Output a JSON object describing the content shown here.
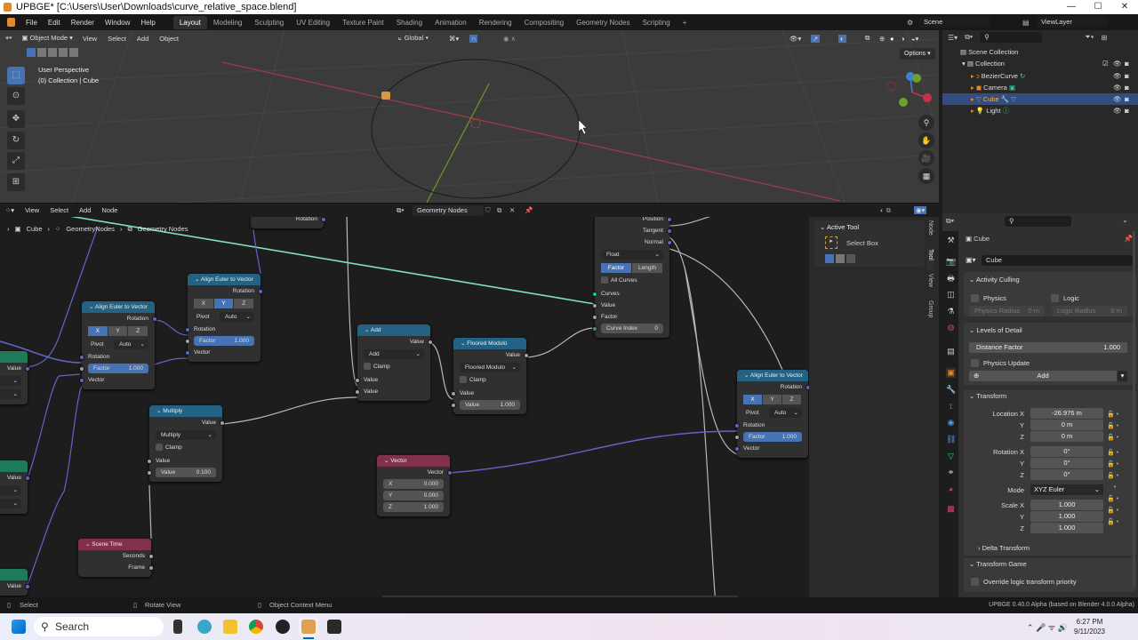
{
  "window": {
    "title": "UPBGE* [C:\\Users\\User\\Downloads\\curve_relative_space.blend]",
    "controls": [
      "—",
      "☐",
      "✕"
    ]
  },
  "topbar": {
    "menus": [
      "File",
      "Edit",
      "Render",
      "Window",
      "Help"
    ],
    "workspaces": [
      "Layout",
      "Modeling",
      "Sculpting",
      "UV Editing",
      "Texture Paint",
      "Shading",
      "Animation",
      "Rendering",
      "Compositing",
      "Geometry Nodes",
      "Scripting"
    ],
    "active_workspace": "Layout",
    "add_workspace": "+",
    "scene": "Scene",
    "view_layer": "ViewLayer"
  },
  "viewport": {
    "mode": "Object Mode",
    "menus": [
      "View",
      "Select",
      "Add",
      "Object"
    ],
    "orientation": "Global",
    "options_label": "Options",
    "overlay_line1": "User Perspective",
    "overlay_line2": "(0) Collection | Cube",
    "gizmo_axes": [
      "X",
      "Y",
      "Z"
    ],
    "axis_colors": {
      "x": "#c8304a",
      "y": "#6aa12a",
      "z": "#3d82d6"
    }
  },
  "node_editor": {
    "menus": [
      "View",
      "Select",
      "Add",
      "Node"
    ],
    "node_tree": "Geometry Nodes",
    "breadcrumb": [
      "Cube",
      "GeometryNodes",
      "Geometry Nodes"
    ],
    "nodes": [
      {
        "title": "",
        "color": "#303030",
        "rows": [
          {
            "t": "out",
            "label": "Rotation",
            "s": "#6363c7"
          }
        ]
      },
      {
        "title": "Align Euler to Vector",
        "color": "#246283",
        "rows": [
          {
            "t": "out",
            "label": "Rotation",
            "s": "#6363c7"
          },
          {
            "t": "seg",
            "options": [
              "X",
              "Y",
              "Z"
            ],
            "active": "X"
          },
          {
            "t": "sel",
            "label": "Pivot",
            "value": "Auto"
          },
          {
            "t": "in",
            "label": "Rotation",
            "s": "#6363c7"
          },
          {
            "t": "field",
            "label": "Factor",
            "value": "1.000",
            "hl": true,
            "s": "#a1a1a1"
          },
          {
            "t": "in",
            "label": "Vector",
            "s": "#6363c7"
          }
        ]
      },
      {
        "title": "Align Euler to Vector",
        "color": "#246283",
        "rows": [
          {
            "t": "out",
            "label": "Rotation",
            "s": "#6363c7"
          },
          {
            "t": "seg",
            "options": [
              "X",
              "Y",
              "Z"
            ],
            "active": "Y"
          },
          {
            "t": "sel",
            "label": "Pivot",
            "value": "Auto"
          },
          {
            "t": "in",
            "label": "Rotation",
            "s": "#6363c7"
          },
          {
            "t": "field",
            "label": "Factor",
            "value": "1.000",
            "hl": true,
            "s": "#a1a1a1"
          },
          {
            "t": "in",
            "label": "Vector",
            "s": "#6363c7"
          }
        ]
      },
      {
        "title": "Align Euler to Vector",
        "color": "#246283",
        "rows": [
          {
            "t": "out",
            "label": "Rotation",
            "s": "#6363c7"
          },
          {
            "t": "seg",
            "options": [
              "X",
              "Y",
              "Z"
            ],
            "active": "X"
          },
          {
            "t": "sel",
            "label": "Pivot",
            "value": "Auto"
          },
          {
            "t": "in",
            "label": "Rotation",
            "s": "#6363c7"
          },
          {
            "t": "field",
            "label": "Factor",
            "value": "1.000",
            "hl": true,
            "s": "#a1a1a1"
          },
          {
            "t": "in",
            "label": "Vector",
            "s": "#6363c7"
          }
        ]
      },
      {
        "title": "Add",
        "color": "#246283",
        "rows": [
          {
            "t": "out",
            "label": "Value",
            "s": "#a1a1a1"
          },
          {
            "t": "sel",
            "value": "Add"
          },
          {
            "t": "check",
            "label": "Clamp"
          },
          {
            "t": "in",
            "label": "Value",
            "s": "#a1a1a1"
          },
          {
            "t": "in",
            "label": "Value",
            "s": "#a1a1a1"
          }
        ]
      },
      {
        "title": "Floored Modulo",
        "color": "#246283",
        "rows": [
          {
            "t": "out",
            "label": "Value",
            "s": "#a1a1a1"
          },
          {
            "t": "sel",
            "value": "Floored Modulo"
          },
          {
            "t": "check",
            "label": "Clamp"
          },
          {
            "t": "in",
            "label": "Value",
            "s": "#a1a1a1"
          },
          {
            "t": "field",
            "label": "Value",
            "value": "1.000",
            "s": "#a1a1a1"
          }
        ]
      },
      {
        "title": "",
        "color": "#303030",
        "rows": [
          {
            "t": "out",
            "label": "Position",
            "s": "#6363c7"
          },
          {
            "t": "out",
            "label": "Tangent",
            "s": "#6363c7"
          },
          {
            "t": "out",
            "label": "Normal",
            "s": "#6363c7"
          },
          {
            "t": "sel",
            "value": "Float"
          },
          {
            "t": "seg",
            "options": [
              "Factor",
              "Length"
            ],
            "active": "Factor"
          },
          {
            "t": "check",
            "label": "All Curves"
          },
          {
            "t": "in",
            "label": "Curves",
            "s": "#00d6a3"
          },
          {
            "t": "in",
            "label": "Value",
            "s": "#a1a1a1"
          },
          {
            "t": "in",
            "label": "Factor",
            "s": "#a1a1a1"
          },
          {
            "t": "field",
            "label": "Curve Index",
            "value": "0",
            "s": "#598c5c"
          }
        ]
      },
      {
        "title": "Multiply",
        "color": "#246283",
        "rows": [
          {
            "t": "out",
            "label": "Value",
            "s": "#a1a1a1"
          },
          {
            "t": "sel",
            "value": "Multiply"
          },
          {
            "t": "check",
            "label": "Clamp"
          },
          {
            "t": "in",
            "label": "Value",
            "s": "#a1a1a1"
          },
          {
            "t": "field",
            "label": "Value",
            "value": "0.100",
            "s": "#a1a1a1"
          }
        ]
      },
      {
        "title": "Vector",
        "color": "#83314a",
        "rows": [
          {
            "t": "out",
            "label": "Vector",
            "s": "#6363c7"
          },
          {
            "t": "field",
            "label": "X",
            "value": "0.000"
          },
          {
            "t": "field",
            "label": "Y",
            "value": "0.000"
          },
          {
            "t": "field",
            "label": "Z",
            "value": "1.000"
          }
        ]
      },
      {
        "title": "Scene Time",
        "color": "#83314a",
        "rows": [
          {
            "t": "out",
            "label": "Seconds",
            "s": "#a1a1a1"
          },
          {
            "t": "out",
            "label": "Frame",
            "s": "#a1a1a1"
          }
        ]
      },
      {
        "title": "x",
        "color": "#1f7a5a",
        "rows": [
          {
            "t": "out",
            "label": "Value",
            "s": "#6363c7"
          },
          {
            "t": "sel",
            "value": ""
          },
          {
            "t": "sel",
            "value": ""
          }
        ]
      },
      {
        "title": "x",
        "color": "#1f7a5a",
        "rows": [
          {
            "t": "out",
            "label": "Value",
            "s": "#6363c7"
          },
          {
            "t": "sel",
            "value": ""
          },
          {
            "t": "sel",
            "value": ""
          }
        ]
      },
      {
        "title": "ex",
        "color": "#1f7a5a",
        "rows": [
          {
            "t": "out",
            "label": "Value",
            "s": "#6363c7"
          }
        ]
      }
    ],
    "sidebar": {
      "panel": "Active Tool",
      "tool": "Select Box",
      "tabs": [
        "Node",
        "Tool",
        "View",
        "Group"
      ]
    }
  },
  "outliner": {
    "items": [
      {
        "label": "Scene Collection",
        "icon": "collection-icon"
      },
      {
        "label": "Collection",
        "icon": "collection-icon"
      },
      {
        "label": "BezierCurve",
        "icon": "curve-icon"
      },
      {
        "label": "Camera",
        "icon": "camera-icon"
      },
      {
        "label": "Cube",
        "icon": "mesh-icon",
        "selected": true
      },
      {
        "label": "Light",
        "icon": "light-icon"
      }
    ]
  },
  "properties": {
    "object_name": "Cube",
    "data_name": "Cube",
    "activity_culling": {
      "title": "Activity Culling",
      "physics": "Physics",
      "logic": "Logic",
      "physics_radius": "Physics Radius",
      "physics_radius_value": "0 m",
      "logic_radius": "Logic Radius",
      "logic_radius_value": "0 m"
    },
    "lod": {
      "title": "Levels of Detail",
      "distance_factor": "Distance Factor",
      "distance_factor_value": "1.000",
      "physics_update": "Physics Update",
      "add": "Add"
    },
    "transform": {
      "title": "Transform",
      "location_label": "Location X",
      "location": [
        "-26.976 m",
        "0 m",
        "0 m"
      ],
      "rotation_label": "Rotation X",
      "rotation": [
        "0°",
        "0°",
        "0°"
      ],
      "mode_label": "Mode",
      "mode": "XYZ Euler",
      "scale_label": "Scale X",
      "scale": [
        "1.000",
        "1.000",
        "1.000"
      ],
      "y": "Y",
      "z": "Z",
      "delta": "Delta Transform"
    },
    "transform_game": {
      "title": "Transform Game",
      "override": "Override logic transform priority"
    }
  },
  "statusbar": {
    "select": "Select",
    "rotate": "Rotate View",
    "context": "Object Context Menu",
    "version": "UPBGE 0.40.0 Alpha (based on Blender 4.0.0 Alpha)"
  },
  "taskbar": {
    "search": "Search",
    "time": "6:27 PM",
    "date": "9/11/2023"
  }
}
